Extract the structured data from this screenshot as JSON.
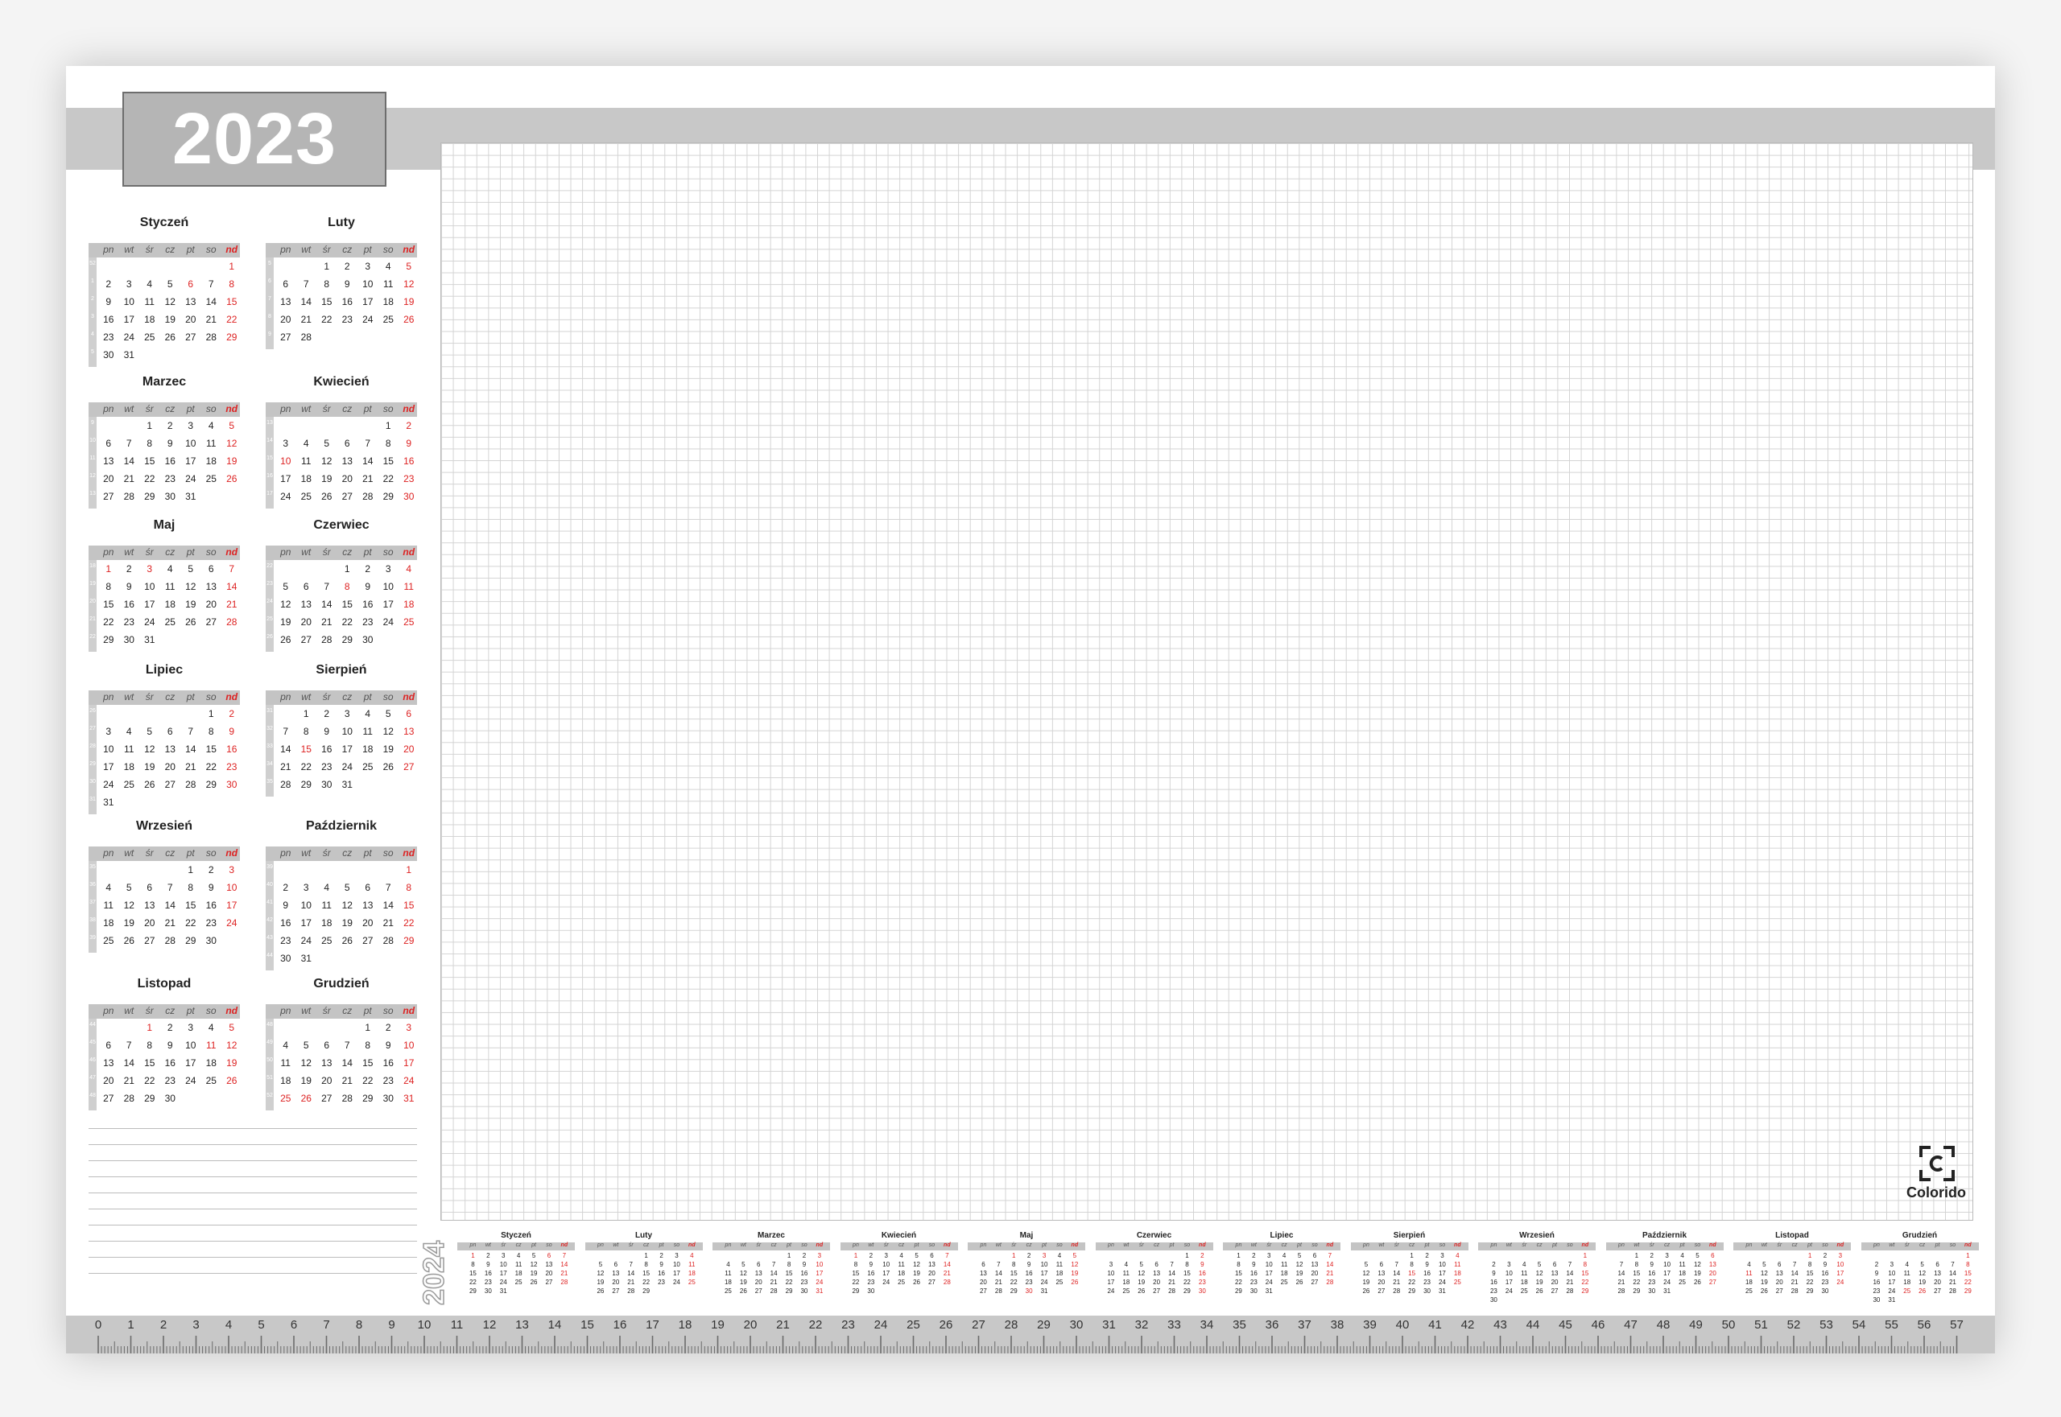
{
  "year": "2023",
  "next_year": "2024",
  "brand": "Colorido",
  "day_headers": [
    "pn",
    "wt",
    "śr",
    "cz",
    "pt",
    "so",
    "nd"
  ],
  "months": [
    {
      "name": "Styczeń",
      "weeks": [
        [
          null,
          null,
          null,
          null,
          null,
          null,
          1
        ],
        [
          2,
          3,
          4,
          5,
          6,
          7,
          8
        ],
        [
          9,
          10,
          11,
          12,
          13,
          14,
          15
        ],
        [
          16,
          17,
          18,
          19,
          20,
          21,
          22
        ],
        [
          23,
          24,
          25,
          26,
          27,
          28,
          29
        ],
        [
          30,
          31,
          null,
          null,
          null,
          null,
          null
        ]
      ],
      "week_numbers": [
        52,
        1,
        2,
        3,
        4,
        5
      ],
      "holidays": [
        1,
        6
      ]
    },
    {
      "name": "Luty",
      "weeks": [
        [
          null,
          null,
          1,
          2,
          3,
          4,
          5
        ],
        [
          6,
          7,
          8,
          9,
          10,
          11,
          12
        ],
        [
          13,
          14,
          15,
          16,
          17,
          18,
          19
        ],
        [
          20,
          21,
          22,
          23,
          24,
          25,
          26
        ],
        [
          27,
          28,
          null,
          null,
          null,
          null,
          null
        ]
      ],
      "week_numbers": [
        5,
        6,
        7,
        8,
        9
      ],
      "holidays": []
    },
    {
      "name": "Marzec",
      "weeks": [
        [
          null,
          null,
          1,
          2,
          3,
          4,
          5
        ],
        [
          6,
          7,
          8,
          9,
          10,
          11,
          12
        ],
        [
          13,
          14,
          15,
          16,
          17,
          18,
          19
        ],
        [
          20,
          21,
          22,
          23,
          24,
          25,
          26
        ],
        [
          27,
          28,
          29,
          30,
          31,
          null,
          null
        ]
      ],
      "week_numbers": [
        9,
        10,
        11,
        12,
        13
      ],
      "holidays": []
    },
    {
      "name": "Kwiecień",
      "weeks": [
        [
          null,
          null,
          null,
          null,
          null,
          1,
          2
        ],
        [
          3,
          4,
          5,
          6,
          7,
          8,
          9
        ],
        [
          10,
          11,
          12,
          13,
          14,
          15,
          16
        ],
        [
          17,
          18,
          19,
          20,
          21,
          22,
          23
        ],
        [
          24,
          25,
          26,
          27,
          28,
          29,
          30
        ]
      ],
      "week_numbers": [
        13,
        14,
        15,
        16,
        17
      ],
      "holidays": [
        9,
        10
      ]
    },
    {
      "name": "Maj",
      "weeks": [
        [
          1,
          2,
          3,
          4,
          5,
          6,
          7
        ],
        [
          8,
          9,
          10,
          11,
          12,
          13,
          14
        ],
        [
          15,
          16,
          17,
          18,
          19,
          20,
          21
        ],
        [
          22,
          23,
          24,
          25,
          26,
          27,
          28
        ],
        [
          29,
          30,
          31,
          null,
          null,
          null,
          null
        ]
      ],
      "week_numbers": [
        18,
        19,
        20,
        21,
        22
      ],
      "holidays": [
        1,
        3,
        28
      ]
    },
    {
      "name": "Czerwiec",
      "weeks": [
        [
          null,
          null,
          null,
          1,
          2,
          3,
          4
        ],
        [
          5,
          6,
          7,
          8,
          9,
          10,
          11
        ],
        [
          12,
          13,
          14,
          15,
          16,
          17,
          18
        ],
        [
          19,
          20,
          21,
          22,
          23,
          24,
          25
        ],
        [
          26,
          27,
          28,
          29,
          30,
          null,
          null
        ]
      ],
      "week_numbers": [
        22,
        23,
        24,
        25,
        26
      ],
      "holidays": [
        8
      ]
    },
    {
      "name": "Lipiec",
      "weeks": [
        [
          null,
          null,
          null,
          null,
          null,
          1,
          2
        ],
        [
          3,
          4,
          5,
          6,
          7,
          8,
          9
        ],
        [
          10,
          11,
          12,
          13,
          14,
          15,
          16
        ],
        [
          17,
          18,
          19,
          20,
          21,
          22,
          23
        ],
        [
          24,
          25,
          26,
          27,
          28,
          29,
          30
        ],
        [
          31,
          null,
          null,
          null,
          null,
          null,
          null
        ]
      ],
      "week_numbers": [
        26,
        27,
        28,
        29,
        30,
        31
      ],
      "holidays": []
    },
    {
      "name": "Sierpień",
      "weeks": [
        [
          null,
          1,
          2,
          3,
          4,
          5,
          6
        ],
        [
          7,
          8,
          9,
          10,
          11,
          12,
          13
        ],
        [
          14,
          15,
          16,
          17,
          18,
          19,
          20
        ],
        [
          21,
          22,
          23,
          24,
          25,
          26,
          27
        ],
        [
          28,
          29,
          30,
          31,
          null,
          null,
          null
        ]
      ],
      "week_numbers": [
        31,
        32,
        33,
        34,
        35
      ],
      "holidays": [
        15
      ]
    },
    {
      "name": "Wrzesień",
      "weeks": [
        [
          null,
          null,
          null,
          null,
          1,
          2,
          3
        ],
        [
          4,
          5,
          6,
          7,
          8,
          9,
          10
        ],
        [
          11,
          12,
          13,
          14,
          15,
          16,
          17
        ],
        [
          18,
          19,
          20,
          21,
          22,
          23,
          24
        ],
        [
          25,
          26,
          27,
          28,
          29,
          30,
          null
        ]
      ],
      "week_numbers": [
        35,
        36,
        37,
        38,
        39
      ],
      "holidays": []
    },
    {
      "name": "Październik",
      "weeks": [
        [
          null,
          null,
          null,
          null,
          null,
          null,
          1
        ],
        [
          2,
          3,
          4,
          5,
          6,
          7,
          8
        ],
        [
          9,
          10,
          11,
          12,
          13,
          14,
          15
        ],
        [
          16,
          17,
          18,
          19,
          20,
          21,
          22
        ],
        [
          23,
          24,
          25,
          26,
          27,
          28,
          29
        ],
        [
          30,
          31,
          null,
          null,
          null,
          null,
          null
        ]
      ],
      "week_numbers": [
        39,
        40,
        41,
        42,
        43,
        44
      ],
      "holidays": []
    },
    {
      "name": "Listopad",
      "weeks": [
        [
          null,
          null,
          1,
          2,
          3,
          4,
          5
        ],
        [
          6,
          7,
          8,
          9,
          10,
          11,
          12
        ],
        [
          13,
          14,
          15,
          16,
          17,
          18,
          19
        ],
        [
          20,
          21,
          22,
          23,
          24,
          25,
          26
        ],
        [
          27,
          28,
          29,
          30,
          null,
          null,
          null
        ]
      ],
      "week_numbers": [
        44,
        45,
        46,
        47,
        48
      ],
      "holidays": [
        1,
        11
      ]
    },
    {
      "name": "Grudzień",
      "weeks": [
        [
          null,
          null,
          null,
          null,
          1,
          2,
          3
        ],
        [
          4,
          5,
          6,
          7,
          8,
          9,
          10
        ],
        [
          11,
          12,
          13,
          14,
          15,
          16,
          17
        ],
        [
          18,
          19,
          20,
          21,
          22,
          23,
          24
        ],
        [
          25,
          26,
          27,
          28,
          29,
          30,
          31
        ]
      ],
      "week_numbers": [
        48,
        49,
        50,
        51,
        52
      ],
      "holidays": [
        25,
        26
      ]
    }
  ],
  "months_2024": [
    {
      "name": "Styczeń",
      "weeks": [
        [
          1,
          2,
          3,
          4,
          5,
          6,
          7
        ],
        [
          8,
          9,
          10,
          11,
          12,
          13,
          14
        ],
        [
          15,
          16,
          17,
          18,
          19,
          20,
          21
        ],
        [
          22,
          23,
          24,
          25,
          26,
          27,
          28
        ],
        [
          29,
          30,
          31,
          null,
          null,
          null,
          null
        ]
      ],
      "holidays": [
        1,
        6
      ]
    },
    {
      "name": "Luty",
      "weeks": [
        [
          null,
          null,
          null,
          1,
          2,
          3,
          4
        ],
        [
          5,
          6,
          7,
          8,
          9,
          10,
          11
        ],
        [
          12,
          13,
          14,
          15,
          16,
          17,
          18
        ],
        [
          19,
          20,
          21,
          22,
          23,
          24,
          25
        ],
        [
          26,
          27,
          28,
          29,
          null,
          null,
          null
        ]
      ],
      "holidays": []
    },
    {
      "name": "Marzec",
      "weeks": [
        [
          null,
          null,
          null,
          null,
          1,
          2,
          3
        ],
        [
          4,
          5,
          6,
          7,
          8,
          9,
          10
        ],
        [
          11,
          12,
          13,
          14,
          15,
          16,
          17
        ],
        [
          18,
          19,
          20,
          21,
          22,
          23,
          24
        ],
        [
          25,
          26,
          27,
          28,
          29,
          30,
          31
        ]
      ],
      "holidays": [
        31
      ]
    },
    {
      "name": "Kwiecień",
      "weeks": [
        [
          1,
          2,
          3,
          4,
          5,
          6,
          7
        ],
        [
          8,
          9,
          10,
          11,
          12,
          13,
          14
        ],
        [
          15,
          16,
          17,
          18,
          19,
          20,
          21
        ],
        [
          22,
          23,
          24,
          25,
          26,
          27,
          28
        ],
        [
          29,
          30,
          null,
          null,
          null,
          null,
          null
        ]
      ],
      "holidays": [
        1
      ]
    },
    {
      "name": "Maj",
      "weeks": [
        [
          null,
          null,
          1,
          2,
          3,
          4,
          5
        ],
        [
          6,
          7,
          8,
          9,
          10,
          11,
          12
        ],
        [
          13,
          14,
          15,
          16,
          17,
          18,
          19
        ],
        [
          20,
          21,
          22,
          23,
          24,
          25,
          26
        ],
        [
          27,
          28,
          29,
          30,
          31,
          null,
          null
        ]
      ],
      "holidays": [
        1,
        3,
        30
      ]
    },
    {
      "name": "Czerwiec",
      "weeks": [
        [
          null,
          null,
          null,
          null,
          null,
          1,
          2
        ],
        [
          3,
          4,
          5,
          6,
          7,
          8,
          9
        ],
        [
          10,
          11,
          12,
          13,
          14,
          15,
          16
        ],
        [
          17,
          18,
          19,
          20,
          21,
          22,
          23
        ],
        [
          24,
          25,
          26,
          27,
          28,
          29,
          30
        ]
      ],
      "holidays": []
    },
    {
      "name": "Lipiec",
      "weeks": [
        [
          1,
          2,
          3,
          4,
          5,
          6,
          7
        ],
        [
          8,
          9,
          10,
          11,
          12,
          13,
          14
        ],
        [
          15,
          16,
          17,
          18,
          19,
          20,
          21
        ],
        [
          22,
          23,
          24,
          25,
          26,
          27,
          28
        ],
        [
          29,
          30,
          31,
          null,
          null,
          null,
          null
        ]
      ],
      "holidays": []
    },
    {
      "name": "Sierpień",
      "weeks": [
        [
          null,
          null,
          null,
          1,
          2,
          3,
          4
        ],
        [
          5,
          6,
          7,
          8,
          9,
          10,
          11
        ],
        [
          12,
          13,
          14,
          15,
          16,
          17,
          18
        ],
        [
          19,
          20,
          21,
          22,
          23,
          24,
          25
        ],
        [
          26,
          27,
          28,
          29,
          30,
          31,
          null
        ]
      ],
      "holidays": [
        15
      ]
    },
    {
      "name": "Wrzesień",
      "weeks": [
        [
          null,
          null,
          null,
          null,
          null,
          null,
          1
        ],
        [
          2,
          3,
          4,
          5,
          6,
          7,
          8
        ],
        [
          9,
          10,
          11,
          12,
          13,
          14,
          15
        ],
        [
          16,
          17,
          18,
          19,
          20,
          21,
          22
        ],
        [
          23,
          24,
          25,
          26,
          27,
          28,
          29
        ],
        [
          30,
          null,
          null,
          null,
          null,
          null,
          null
        ]
      ],
      "holidays": []
    },
    {
      "name": "Październik",
      "weeks": [
        [
          null,
          1,
          2,
          3,
          4,
          5,
          6
        ],
        [
          7,
          8,
          9,
          10,
          11,
          12,
          13
        ],
        [
          14,
          15,
          16,
          17,
          18,
          19,
          20
        ],
        [
          21,
          22,
          23,
          24,
          25,
          26,
          27
        ],
        [
          28,
          29,
          30,
          31,
          null,
          null,
          null
        ]
      ],
      "holidays": []
    },
    {
      "name": "Listopad",
      "weeks": [
        [
          null,
          null,
          null,
          null,
          1,
          2,
          3
        ],
        [
          4,
          5,
          6,
          7,
          8,
          9,
          10
        ],
        [
          11,
          12,
          13,
          14,
          15,
          16,
          17
        ],
        [
          18,
          19,
          20,
          21,
          22,
          23,
          24
        ],
        [
          25,
          26,
          27,
          28,
          29,
          30,
          null
        ]
      ],
      "holidays": [
        1,
        11
      ]
    },
    {
      "name": "Grudzień",
      "weeks": [
        [
          null,
          null,
          null,
          null,
          null,
          null,
          1
        ],
        [
          2,
          3,
          4,
          5,
          6,
          7,
          8
        ],
        [
          9,
          10,
          11,
          12,
          13,
          14,
          15
        ],
        [
          16,
          17,
          18,
          19,
          20,
          21,
          22
        ],
        [
          23,
          24,
          25,
          26,
          27,
          28,
          29
        ],
        [
          30,
          31,
          null,
          null,
          null,
          null,
          null
        ]
      ],
      "holidays": [
        25,
        26
      ]
    }
  ],
  "ruler_labels": [
    "0",
    "1",
    "2",
    "3",
    "4",
    "5",
    "6",
    "7",
    "8",
    "9",
    "10",
    "11",
    "12",
    "13",
    "14",
    "15",
    "16",
    "17",
    "18",
    "19",
    "20",
    "21",
    "22",
    "23",
    "24",
    "25",
    "26",
    "27",
    "28",
    "29",
    "30",
    "31",
    "32",
    "33",
    "34",
    "35",
    "36",
    "37",
    "38",
    "39",
    "40",
    "41",
    "42",
    "43",
    "44",
    "45",
    "46",
    "47",
    "48",
    "49",
    "50",
    "51",
    "52",
    "53",
    "54",
    "55",
    "56",
    "57"
  ],
  "colors": {
    "band": "#c8c8c8",
    "year_box": "#b5b5b5",
    "holiday": "#dd2222",
    "grid_line": "#d3d3d3"
  }
}
